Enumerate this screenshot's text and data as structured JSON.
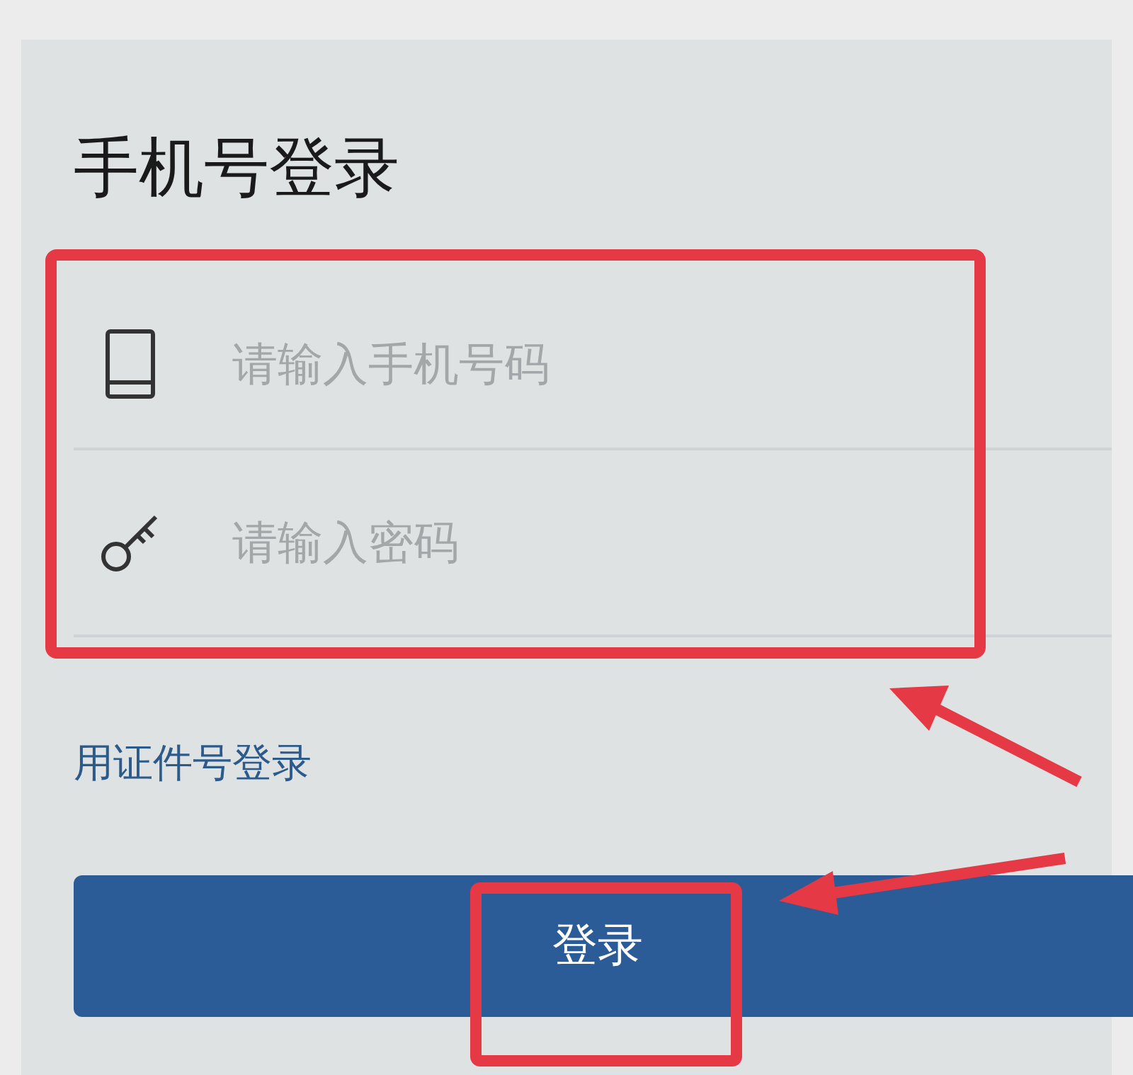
{
  "title": "手机号登录",
  "fields": [
    {
      "kind": "phone",
      "placeholder": "请输入手机号码"
    },
    {
      "kind": "password",
      "placeholder": "请输入密码"
    }
  ],
  "alt_login_link": "用证件号登录",
  "login_button": "登录"
}
